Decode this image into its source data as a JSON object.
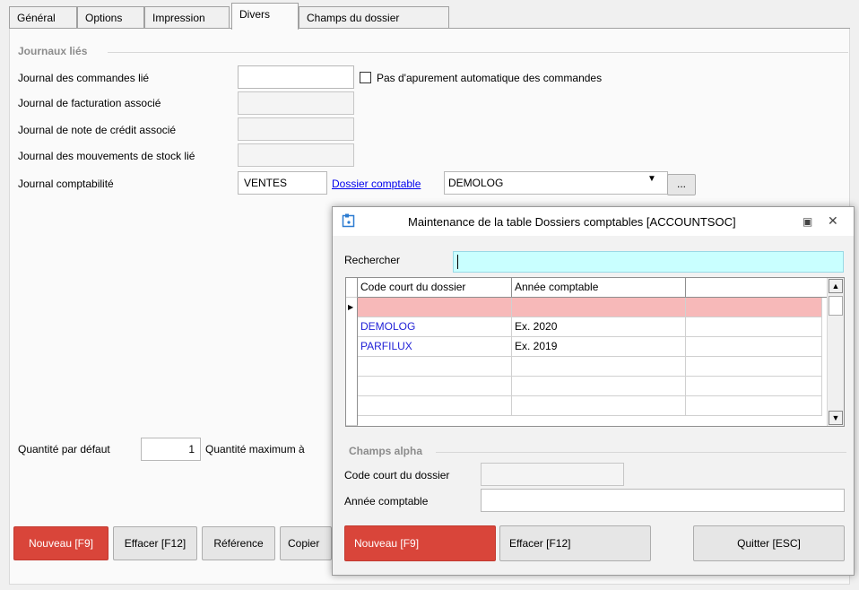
{
  "tabs": [
    {
      "label": "Général"
    },
    {
      "label": "Options"
    },
    {
      "label": "Impression"
    },
    {
      "label": "Divers"
    },
    {
      "label": "Champs du dossier"
    }
  ],
  "journaux": {
    "title": "Journaux liés",
    "commandes_label": "Journal des commandes lié",
    "commandes_value": "",
    "pas_apurement_label": "Pas d'apurement automatique des commandes",
    "facturation_label": "Journal de facturation associé",
    "note_credit_label": "Journal de note de crédit associé",
    "mouvements_label": "Journal des mouvements de stock lié",
    "comptabilite_label": "Journal comptabilité",
    "comptabilite_value": "VENTES",
    "dossier_link": "Dossier comptable",
    "dossier_value": "DEMOLOG",
    "ellipsis_label": "..."
  },
  "quantite": {
    "defaut_label": "Quantité par défaut",
    "defaut_value": "1",
    "maximum_label": "Quantité maximum à"
  },
  "buttons": {
    "nouveau": "Nouveau [F9]",
    "effacer": "Effacer [F12]",
    "reference": "Référence",
    "copier": "Copier"
  },
  "dialog": {
    "title": "Maintenance de la table Dossiers comptables [ACCOUNTSOC]",
    "search_label": "Rechercher",
    "search_value": "",
    "columns": [
      "Code court du dossier",
      "Année comptable",
      ""
    ],
    "rows": [
      {
        "code": "DEMOLOG",
        "annee": "Ex. 2020"
      },
      {
        "code": "PARFILUX",
        "annee": "Ex. 2019"
      }
    ],
    "champs_title": "Champs alpha",
    "code_label": "Code court du dossier",
    "code_value": "",
    "annee_label": "Année comptable",
    "annee_value": "",
    "nouveau": "Nouveau [F9]",
    "effacer": "Effacer [F12]",
    "quitter": "Quitter [ESC]"
  }
}
